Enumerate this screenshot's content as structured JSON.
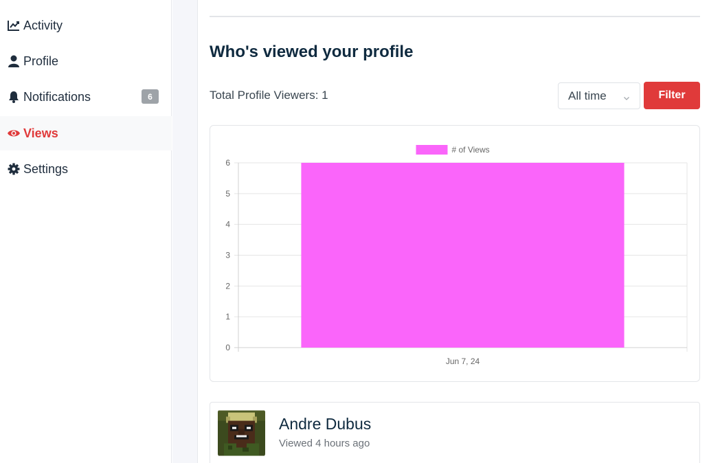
{
  "sidebar": {
    "items": [
      {
        "label": "Activity",
        "icon": "chart-line-icon"
      },
      {
        "label": "Profile",
        "icon": "user-icon"
      },
      {
        "label": "Notifications",
        "icon": "bell-icon",
        "badge": "6"
      },
      {
        "label": "Views",
        "icon": "eye-icon",
        "active": true
      },
      {
        "label": "Settings",
        "icon": "gear-icon"
      }
    ]
  },
  "main": {
    "title": "Who's viewed your profile",
    "total_viewers": "Total Profile Viewers: 1",
    "filter": {
      "selected": "All time",
      "button_label": "Filter"
    }
  },
  "chart_data": {
    "type": "bar",
    "categories": [
      "Jun 7, 24"
    ],
    "series": [
      {
        "name": "# of Views",
        "values": [
          6
        ],
        "color": "#fa65fa"
      }
    ],
    "ylim": [
      0,
      6
    ],
    "yticks": [
      0,
      1,
      2,
      3,
      4,
      5,
      6
    ],
    "grid": true,
    "legend": "top"
  },
  "viewers": [
    {
      "name": "Andre Dubus",
      "time": "Viewed 4 hours ago"
    }
  ],
  "colors": {
    "accent": "#e03a3a",
    "bar": "#fa65fa",
    "title": "#0f2a3f"
  }
}
